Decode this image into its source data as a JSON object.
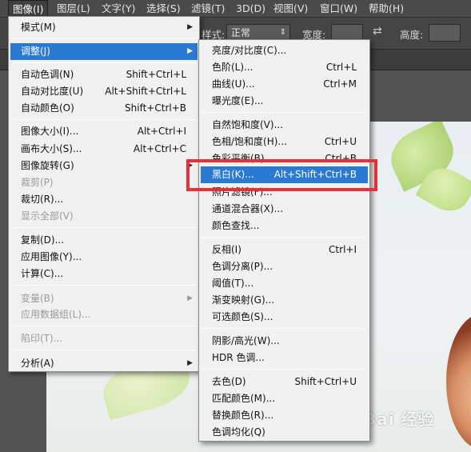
{
  "menubar": [
    "图像(I)",
    "图层(L)",
    "文字(Y)",
    "选择(S)",
    "滤镜(T)",
    "3D(D)",
    "视图(V)",
    "窗口(W)",
    "帮助(H)"
  ],
  "options": {
    "style_label": "样式:",
    "style_value": "正常",
    "width_label": "宽度:",
    "height_label": "高度:"
  },
  "main_menu": {
    "mode": "模式(M)",
    "adjustments": "调整(J)",
    "auto_tone": {
      "label": "自动色调(N)",
      "shortcut": "Shift+Ctrl+L"
    },
    "auto_contrast": {
      "label": "自动对比度(U)",
      "shortcut": "Alt+Shift+Ctrl+L"
    },
    "auto_color": {
      "label": "自动颜色(O)",
      "shortcut": "Shift+Ctrl+B"
    },
    "image_size": {
      "label": "图像大小(I)...",
      "shortcut": "Alt+Ctrl+I"
    },
    "canvas_size": {
      "label": "画布大小(S)...",
      "shortcut": "Alt+Ctrl+C"
    },
    "image_rotation": "图像旋转(G)",
    "crop": "裁剪(P)",
    "trim": "裁切(R)...",
    "reveal_all": "显示全部(V)",
    "duplicate": "复制(D)...",
    "apply_image": "应用图像(Y)...",
    "calculations": "计算(C)...",
    "variables": "变量(B)",
    "apply_data_set": "应用数据组(L)...",
    "trap": "陷印(T)...",
    "analysis": "分析(A)"
  },
  "sub_menu": {
    "brightness_contrast": "亮度/对比度(C)...",
    "levels": {
      "label": "色阶(L)...",
      "shortcut": "Ctrl+L"
    },
    "curves": {
      "label": "曲线(U)...",
      "shortcut": "Ctrl+M"
    },
    "exposure": "曝光度(E)...",
    "vibrance": "自然饱和度(V)...",
    "hue_saturation": {
      "label": "色相/饱和度(H)...",
      "shortcut": "Ctrl+U"
    },
    "color_balance": {
      "label": "色彩平衡(B)...",
      "shortcut": "Ctrl+B"
    },
    "black_white": {
      "label": "黑白(K)...",
      "shortcut": "Alt+Shift+Ctrl+B"
    },
    "photo_filter": "照片滤镜(F)...",
    "channel_mixer": "通道混合器(X)...",
    "color_lookup": "颜色查找...",
    "invert": {
      "label": "反相(I)",
      "shortcut": "Ctrl+I"
    },
    "posterize": "色调分离(P)...",
    "threshold": "阈值(T)...",
    "gradient_map": "渐变映射(G)...",
    "selective_color": "可选颜色(S)...",
    "shadows_highlights": "阴影/高光(W)...",
    "hdr_toning": "HDR 色调...",
    "desaturate": {
      "label": "去色(D)",
      "shortcut": "Shift+Ctrl+U"
    },
    "match_color": "匹配颜色(M)...",
    "replace_color": "替换颜色(R)...",
    "equalize": "色调均化(Q)"
  },
  "watermark": "Bai 经验",
  "colors": {
    "highlight": "#2a79d2",
    "annotation": "#e8303a"
  }
}
